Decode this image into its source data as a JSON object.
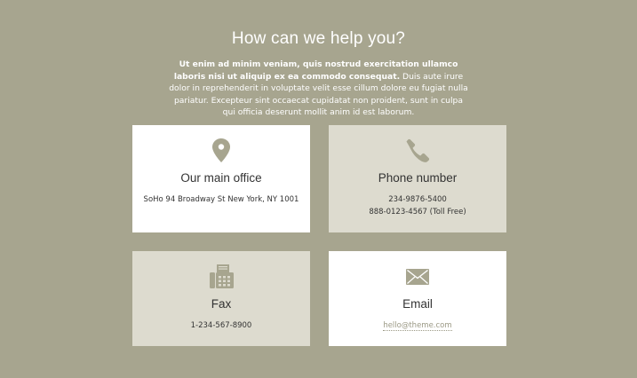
{
  "heading": "How can we help you?",
  "intro": {
    "bold": "Ut enim ad minim veniam, quis nostrud exercitation ullamco laboris nisi ut aliquip ex ea commodo consequat.",
    "rest": " Duis aute irure dolor in reprehenderit in voluptate velit esse cillum dolore eu fugiat nulla pariatur. Excepteur sint occaecat cupidatat non proident, sunt in culpa qui officia deserunt mollit anim id est laborum."
  },
  "cards": {
    "office": {
      "icon": "map-pin-icon",
      "title": "Our main office",
      "line1": "SoHo 94 Broadway St New York, NY 1001"
    },
    "phone": {
      "icon": "phone-icon",
      "title": "Phone number",
      "line1": "234-9876-5400",
      "line2": "888-0123-4567 (Toll Free)"
    },
    "fax": {
      "icon": "fax-icon",
      "title": "Fax",
      "line1": "1-234-567-8900"
    },
    "email": {
      "icon": "envelope-icon",
      "title": "Email",
      "link": "hello@theme.com"
    }
  },
  "colors": {
    "background": "#a7a58f",
    "card_white": "#ffffff",
    "card_beige": "#dddbcf",
    "icon": "#a7a58f"
  }
}
